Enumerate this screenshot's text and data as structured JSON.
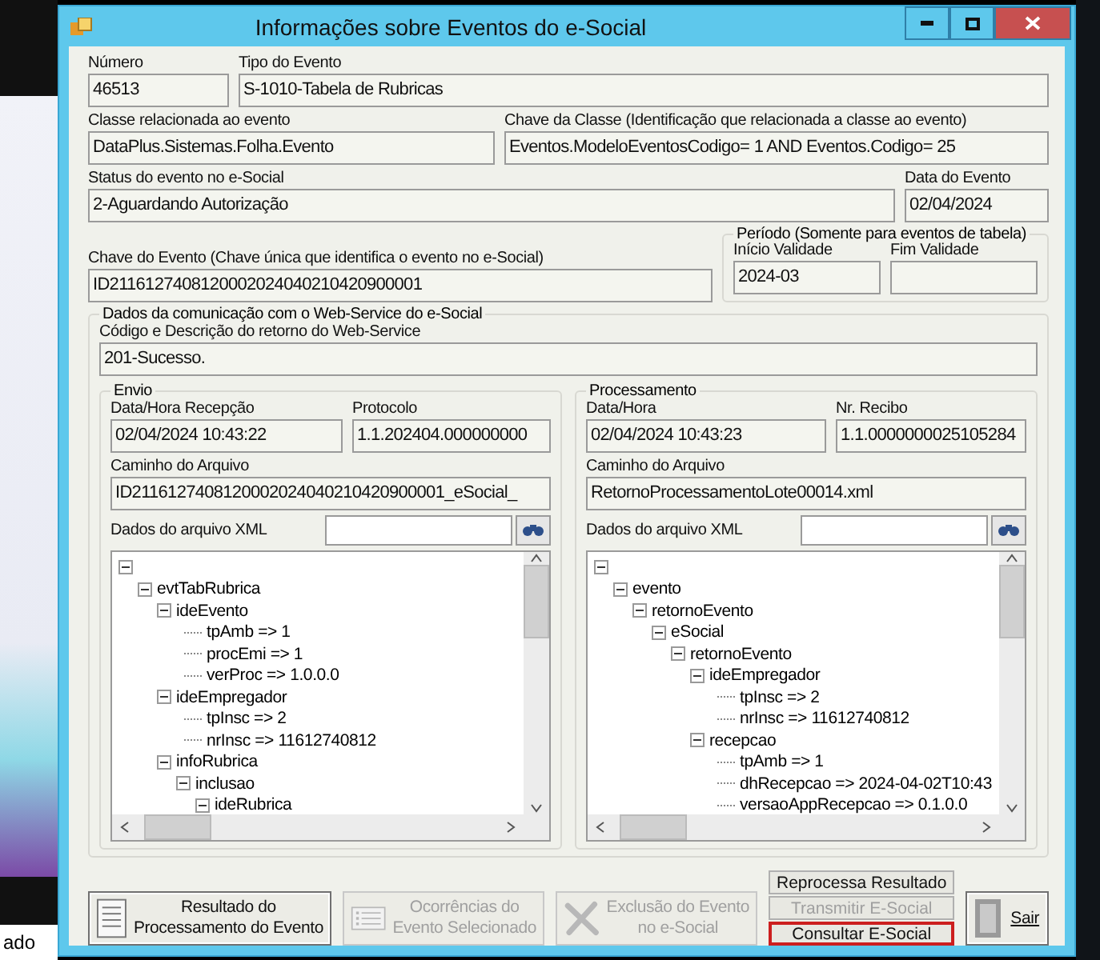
{
  "desktop": {
    "caption": "ado"
  },
  "window": {
    "title": "Informações sobre Eventos do e-Social"
  },
  "numero": {
    "label": "Número",
    "value": "46513"
  },
  "tipo_evento": {
    "label": "Tipo do Evento",
    "value": "S-1010-Tabela de Rubricas"
  },
  "classe": {
    "label": "Classe relacionada ao evento",
    "value": "DataPlus.Sistemas.Folha.Evento"
  },
  "chave_classe": {
    "label": "Chave da Classe (Identificação que relacionada a classe ao evento)",
    "value": "Eventos.ModeloEventosCodigo= 1  AND Eventos.Codigo= 25"
  },
  "status": {
    "label": "Status do evento no e-Social",
    "value": "2-Aguardando Autorização"
  },
  "data_evento": {
    "label": "Data do Evento",
    "value": "02/04/2024"
  },
  "chave_evento": {
    "label": "Chave do Evento (Chave única que identifica o evento no e-Social)",
    "value": "ID2116127408120002024040210420900001"
  },
  "periodo": {
    "title": "Período (Somente para eventos de tabela)",
    "inicio": {
      "label": "Início Validade",
      "value": "2024-03"
    },
    "fim": {
      "label": "Fim Validade"
    }
  },
  "comunicacao": {
    "title": "Dados da comunicação com o Web-Service do e-Social",
    "retorno": {
      "label": "Código e Descrição do retorno do Web-Service",
      "value": "201-Sucesso."
    },
    "envio": {
      "title": "Envio",
      "data_hora": {
        "label": "Data/Hora Recepção",
        "value": "02/04/2024 10:43:22"
      },
      "numero": {
        "label": "Protocolo",
        "value": "1.1.202404.000000000"
      },
      "caminho": {
        "label": "Caminho do Arquivo",
        "value": "ID2116127408120002024040210420900001_eSocial_"
      },
      "xml_label": "Dados do arquivo XML",
      "tree": [
        {
          "expanded": true,
          "children": [
            {
              "label": "evtTabRubrica",
              "expanded": true,
              "children": [
                {
                  "label": "ideEvento",
                  "expanded": true,
                  "children": [
                    {
                      "label": "tpAmb => 1"
                    },
                    {
                      "label": "procEmi => 1"
                    },
                    {
                      "label": "verProc => 1.0.0.0"
                    }
                  ]
                },
                {
                  "label": "ideEmpregador",
                  "expanded": true,
                  "children": [
                    {
                      "label": "tpInsc => 2"
                    },
                    {
                      "label": "nrInsc => 11612740812"
                    }
                  ]
                },
                {
                  "label": "infoRubrica",
                  "expanded": true,
                  "children": [
                    {
                      "label": "inclusao",
                      "expanded": true,
                      "children": [
                        {
                          "label": "ideRubrica",
                          "expanded": true
                        }
                      ]
                    }
                  ]
                }
              ]
            }
          ]
        }
      ]
    },
    "processamento": {
      "title": "Processamento",
      "data_hora": {
        "label": "Data/Hora",
        "value": "02/04/2024 10:43:23"
      },
      "numero": {
        "label": "Nr. Recibo",
        "value": "1.1.0000000025105284"
      },
      "caminho": {
        "label": "Caminho do Arquivo",
        "value": "RetornoProcessamentoLote00014.xml"
      },
      "xml_label": "Dados do arquivo XML",
      "tree": [
        {
          "expanded": true,
          "children": [
            {
              "label": "evento",
              "expanded": true,
              "children": [
                {
                  "label": "retornoEvento",
                  "expanded": true,
                  "children": [
                    {
                      "label": "eSocial",
                      "expanded": true,
                      "children": [
                        {
                          "label": "retornoEvento",
                          "expanded": true,
                          "children": [
                            {
                              "label": "ideEmpregador",
                              "expanded": true,
                              "children": [
                                {
                                  "label": "tpInsc => 2"
                                },
                                {
                                  "label": "nrInsc => 11612740812"
                                }
                              ]
                            },
                            {
                              "label": "recepcao",
                              "expanded": true,
                              "children": [
                                {
                                  "label": "tpAmb => 1"
                                },
                                {
                                  "label": "dhRecepcao => 2024-04-02T10:43"
                                },
                                {
                                  "label": "versaoAppRecepcao => 0.1.0.0"
                                }
                              ]
                            }
                          ]
                        }
                      ]
                    }
                  ]
                }
              ]
            }
          ]
        }
      ]
    }
  },
  "buttons": [
    {
      "kind": "document",
      "label": "Resultado do\nProcessamento do Evento",
      "disabled": false
    },
    {
      "kind": "list",
      "label": "Ocorrências do\nEvento Selecionado",
      "disabled": true
    },
    {
      "kind": "delete",
      "label": "Exclusão do Evento\nno e-Social",
      "disabled": true
    }
  ],
  "actions": [
    {
      "label": "Reprocessa Resultado",
      "disabled": false,
      "highlighted": false
    },
    {
      "label": "Transmitir E-Social",
      "disabled": true,
      "highlighted": false
    },
    {
      "label": "Consultar E-Social",
      "disabled": false,
      "highlighted": true
    }
  ],
  "exit_button": {
    "label": "Sair",
    "disabled": false
  }
}
